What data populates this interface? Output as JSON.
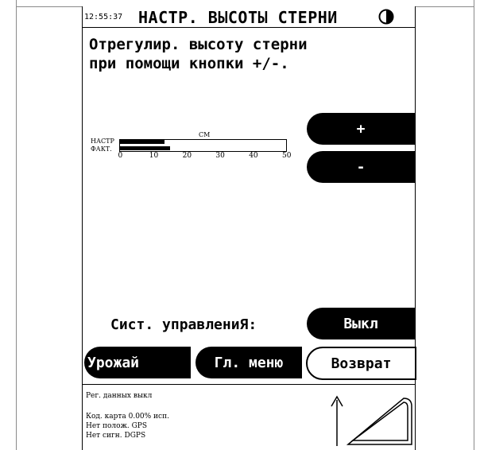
{
  "header": {
    "time": "12:55:37",
    "title": "НАСТР. ВЫСОТЫ СТЕРНИ",
    "contrast_icon": "contrast-icon"
  },
  "instruction": "Отрегулир. высоту стерни\nпри помощи кнопки +/-.",
  "gauge": {
    "unit": "СМ",
    "row_labels": {
      "set": "НАСТР",
      "actual": "ФАКТ."
    },
    "ticks": [
      "0",
      "10",
      "20",
      "30",
      "40",
      "50"
    ],
    "axis_min": 0,
    "axis_max": 50,
    "set_value": 13.5,
    "actual_value": 15
  },
  "buttons": {
    "plus": "+",
    "minus": "-",
    "toggle": "Выкл",
    "harvest": "Урожай",
    "main_menu": "Гл. меню",
    "back": "Возврат"
  },
  "system_label": "Сист. управлениЯ:",
  "status": {
    "log": "Рег. данных выкл",
    "card": "Код. карта   0.00% исп.",
    "gps": "Нет полож. GPS",
    "dgps": "Нет сигн. DGPS"
  },
  "icons": {
    "field": "field-coverage-icon"
  }
}
